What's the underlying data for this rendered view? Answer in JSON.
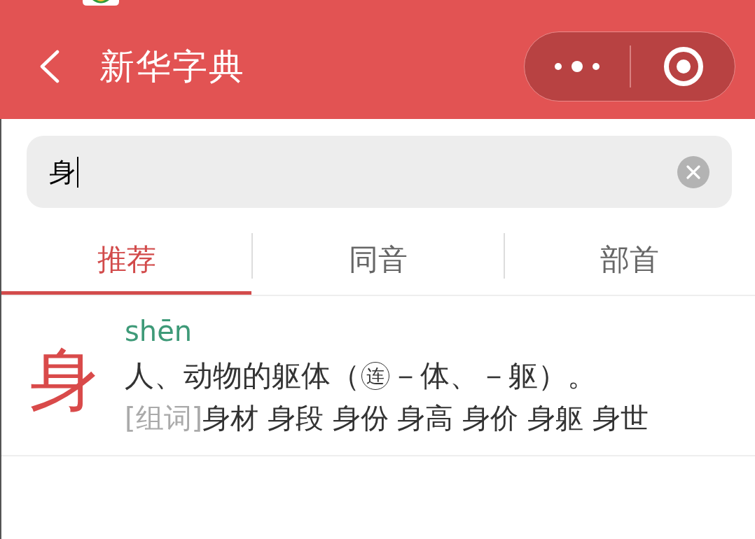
{
  "header": {
    "title": "新华字典"
  },
  "search": {
    "value": "身"
  },
  "tabs": [
    {
      "label": "推荐",
      "selected": true
    },
    {
      "label": "同音",
      "selected": false
    },
    {
      "label": "部首",
      "selected": false
    }
  ],
  "results": [
    {
      "character": "身",
      "pinyin": "shēn",
      "definition": [
        {
          "kind": "plain",
          "text": "人、动物的躯体（"
        },
        {
          "kind": "circled",
          "text": "连"
        },
        {
          "kind": "plain",
          "text": "－体、－躯）。"
        }
      ],
      "words_label": "[组词]",
      "words": [
        "身材",
        "身段",
        "身份",
        "身高",
        "身价",
        "身躯",
        "身世"
      ]
    }
  ]
}
